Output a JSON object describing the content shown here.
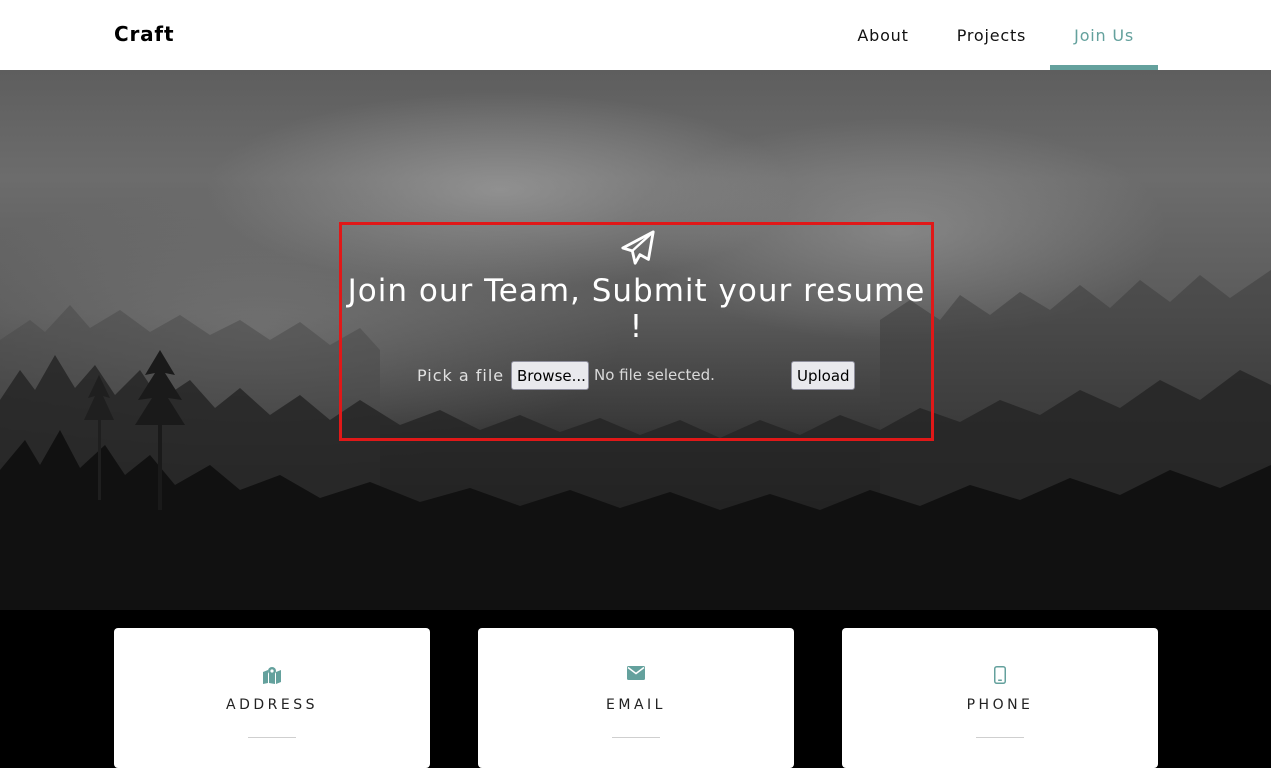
{
  "navbar": {
    "brand": "Craft",
    "links": [
      {
        "label": "About",
        "active": false
      },
      {
        "label": "Projects",
        "active": false
      },
      {
        "label": "Join Us",
        "active": true
      }
    ]
  },
  "hero": {
    "icon": "paper-plane-icon",
    "title": "Join our Team, Submit your resume !",
    "file_label": "Pick a file :",
    "browse_label": "Browse...",
    "file_status": "No file selected.",
    "upload_label": "Upload"
  },
  "contact": {
    "cards": [
      {
        "icon": "map-marked-icon",
        "label": "ADDRESS"
      },
      {
        "icon": "envelope-icon",
        "label": "EMAIL"
      },
      {
        "icon": "mobile-icon",
        "label": "PHONE"
      }
    ]
  },
  "colors": {
    "accent": "#64a19d",
    "highlight_border": "#e01818",
    "navbar_bg": "#ffffff",
    "page_bg": "#000000"
  }
}
